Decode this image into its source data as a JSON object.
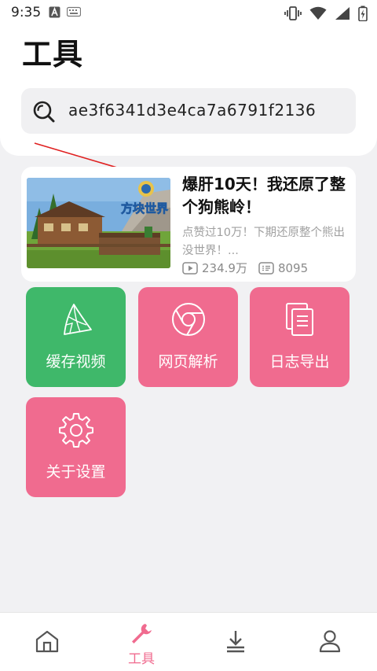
{
  "status_bar": {
    "time": "9:35"
  },
  "header": {
    "title": "工具"
  },
  "search": {
    "value": "ae3f6341d3e4ca7a6791f2136"
  },
  "video": {
    "title": "爆肝10天！我还原了整个狗熊岭！",
    "description": "点赞过10万！下期还原整个熊出没世界！...",
    "views": "234.9万",
    "comments": "8095",
    "thumbnail_logo_text": "方块世界"
  },
  "tools": [
    {
      "label": "缓存视频",
      "icon": "zongzi-icon",
      "color": "#3fb86a"
    },
    {
      "label": "网页解析",
      "icon": "chrome-icon",
      "color": "#f06b8f"
    },
    {
      "label": "日志导出",
      "icon": "document-icon",
      "color": "#f06b8f"
    },
    {
      "label": "关于设置",
      "icon": "gear-icon",
      "color": "#f06b8f"
    }
  ],
  "bottom_nav": {
    "active_label": "工具",
    "active_color": "#f06b8f",
    "items": [
      "home-icon",
      "wrench-icon",
      "download-icon",
      "user-icon"
    ]
  }
}
